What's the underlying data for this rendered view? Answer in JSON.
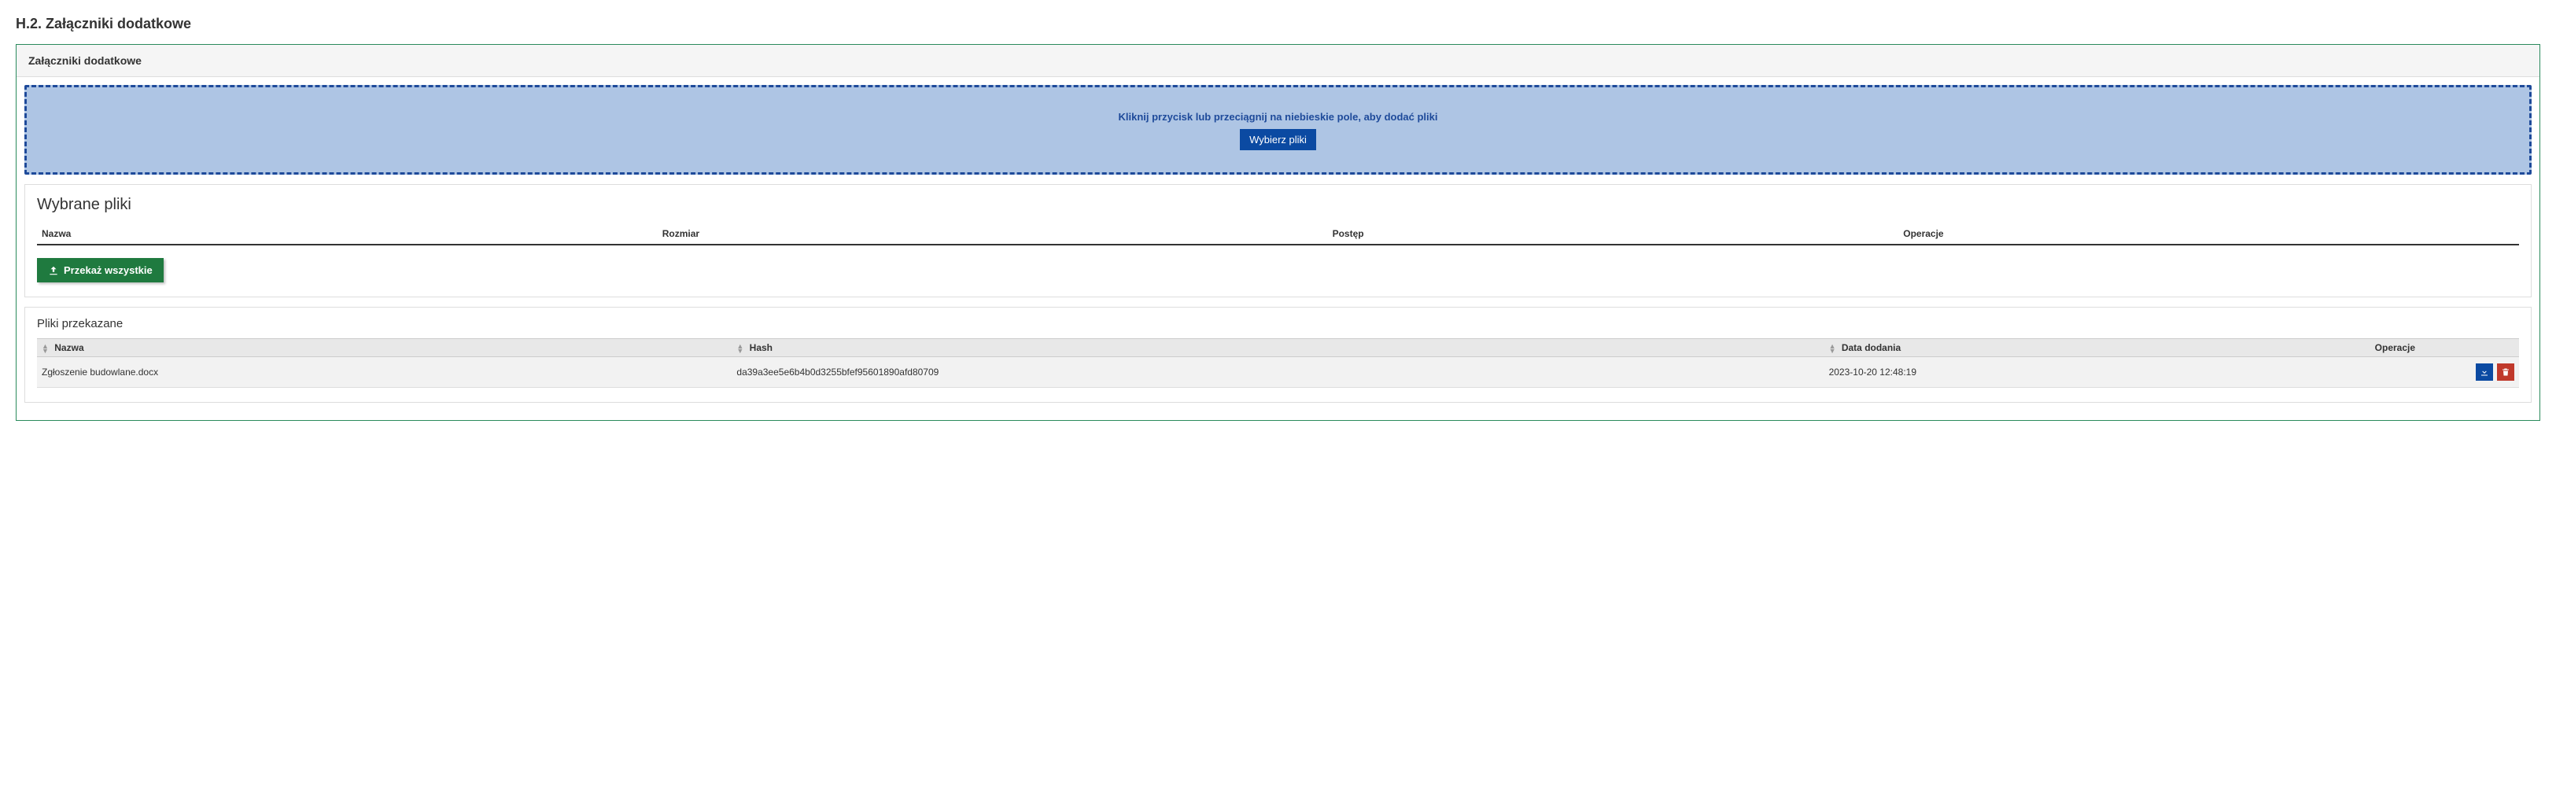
{
  "section_title": "H.2. Załączniki dodatkowe",
  "panel": {
    "header": "Załączniki dodatkowe"
  },
  "dropzone": {
    "hint": "Kliknij przycisk lub przeciągnij na niebieskie pole, aby dodać pliki",
    "button_label": "Wybierz pliki"
  },
  "selected": {
    "title": "Wybrane pliki",
    "cols": {
      "name": "Nazwa",
      "size": "Rozmiar",
      "progress": "Postęp",
      "ops": "Operacje"
    },
    "upload_all_label": "Przekaż wszystkie"
  },
  "transferred": {
    "title": "Pliki przekazane",
    "cols": {
      "name": "Nazwa",
      "hash": "Hash",
      "date": "Data dodania",
      "ops": "Operacje"
    },
    "rows": [
      {
        "name": "Zgłoszenie budowlane.docx",
        "hash": "da39a3ee5e6b4b0d3255bfef95601890afd80709",
        "date": "2023-10-20 12:48:19"
      }
    ]
  }
}
